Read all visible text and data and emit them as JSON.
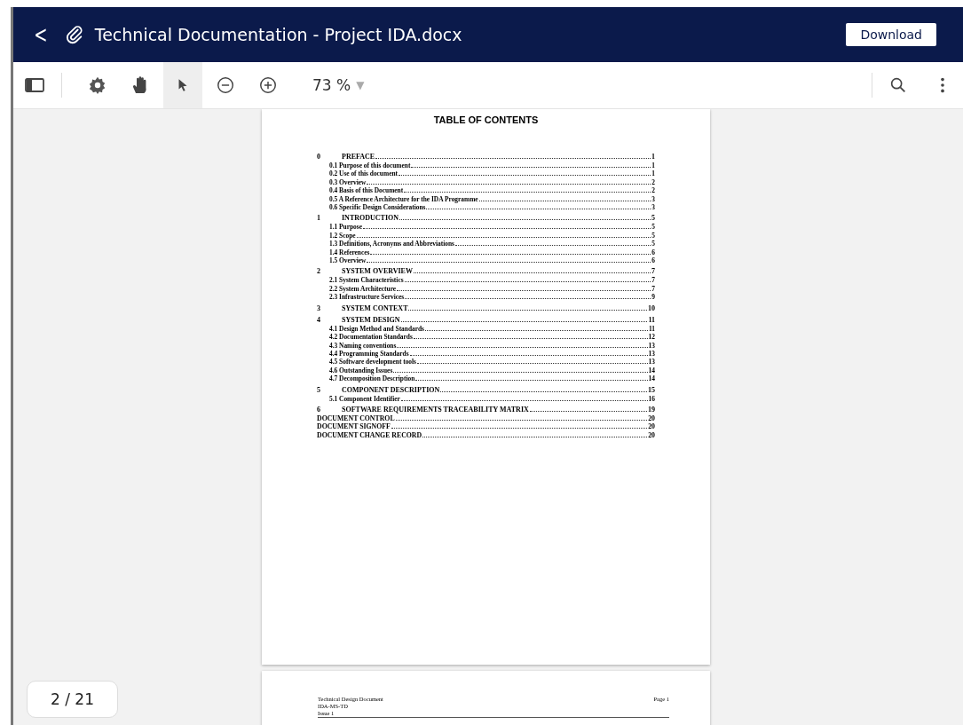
{
  "header": {
    "back": "<",
    "title": "Technical Documentation - Project IDA.docx",
    "download": "Download"
  },
  "toolbar": {
    "tools": [
      {
        "kind": "settings",
        "selected": false
      },
      {
        "kind": "hand",
        "selected": false
      },
      {
        "kind": "pointer",
        "selected": true
      },
      {
        "kind": "zoom-out",
        "selected": false
      },
      {
        "kind": "zoom-in",
        "selected": false
      }
    ],
    "zoom": "73 %",
    "zoom_caret": "▼"
  },
  "page": {
    "heading": "TABLE OF CONTENTS",
    "entries": [
      {
        "kind": "chapter",
        "number": "0",
        "title": "PREFACE",
        "page": "1"
      },
      {
        "kind": "section",
        "title": "0.1 Purpose of this document",
        "page": "1"
      },
      {
        "kind": "section",
        "title": "0.2 Use of this document",
        "page": "1"
      },
      {
        "kind": "section",
        "title": "0.3 Overview",
        "page": "2"
      },
      {
        "kind": "section",
        "title": "0.4 Basis of this Document",
        "page": "2"
      },
      {
        "kind": "section",
        "title": "0.5 A Reference Architecture for the IDA Programme",
        "page": "3"
      },
      {
        "kind": "section",
        "title": "0.6 Specific Design Considerations",
        "page": "3"
      },
      {
        "kind": "chapter",
        "number": "1",
        "title": "INTRODUCTION",
        "page": "5"
      },
      {
        "kind": "section",
        "title": "1.1 Purpose",
        "page": "5"
      },
      {
        "kind": "section",
        "title": "1.2 Scope",
        "page": "5"
      },
      {
        "kind": "section",
        "title": "1.3 Definitions, Acronyms and Abbreviations",
        "page": "5"
      },
      {
        "kind": "section",
        "title": "1.4 References",
        "page": "6"
      },
      {
        "kind": "section",
        "title": "1.5 Overview",
        "page": "6"
      },
      {
        "kind": "chapter",
        "number": "2",
        "title": "SYSTEM OVERVIEW",
        "page": "7"
      },
      {
        "kind": "section",
        "title": "2.1 System Characteristics",
        "page": "7"
      },
      {
        "kind": "section",
        "title": "2.2 System Architecture",
        "page": "7"
      },
      {
        "kind": "section",
        "title": "2.3 Infrastructure Services",
        "page": "9"
      },
      {
        "kind": "chapter",
        "number": "3",
        "title": "SYSTEM CONTEXT",
        "page": "10"
      },
      {
        "kind": "chapter",
        "number": "4",
        "title": "SYSTEM DESIGN",
        "page": "11"
      },
      {
        "kind": "section",
        "title": "4.1 Design Method and Standards",
        "page": "11"
      },
      {
        "kind": "section",
        "title": "4.2 Documentation Standards",
        "page": "12"
      },
      {
        "kind": "section",
        "title": "4.3 Naming conventions",
        "page": "13"
      },
      {
        "kind": "section",
        "title": "4.4 Programming Standards",
        "page": "13"
      },
      {
        "kind": "section",
        "title": "4.5 Software development tools",
        "page": "13"
      },
      {
        "kind": "section",
        "title": "4.6 Outstanding Issues",
        "page": "14"
      },
      {
        "kind": "section",
        "title": "4.7 Decomposition Description",
        "page": "14"
      },
      {
        "kind": "chapter",
        "number": "5",
        "title": "COMPONENT DESCRIPTION",
        "page": "15"
      },
      {
        "kind": "section",
        "title": "5.1 Component Identifier",
        "page": "16"
      },
      {
        "kind": "chapter",
        "number": "6",
        "title": "SOFTWARE REQUIREMENTS TRACEABILITY MATRIX",
        "page": "19"
      },
      {
        "kind": "top",
        "title": "DOCUMENT CONTROL",
        "page": "20"
      },
      {
        "kind": "top",
        "title": "DOCUMENT SIGNOFF",
        "page": "20"
      },
      {
        "kind": "top",
        "title": "DOCUMENT CHANGE RECORD",
        "page": "20"
      }
    ]
  },
  "next_page": {
    "header_left": [
      "Technical Design Document",
      "IDA-MS-TD",
      "Issue 1"
    ],
    "header_right": "Page 1"
  },
  "page_counter": "2 / 21"
}
